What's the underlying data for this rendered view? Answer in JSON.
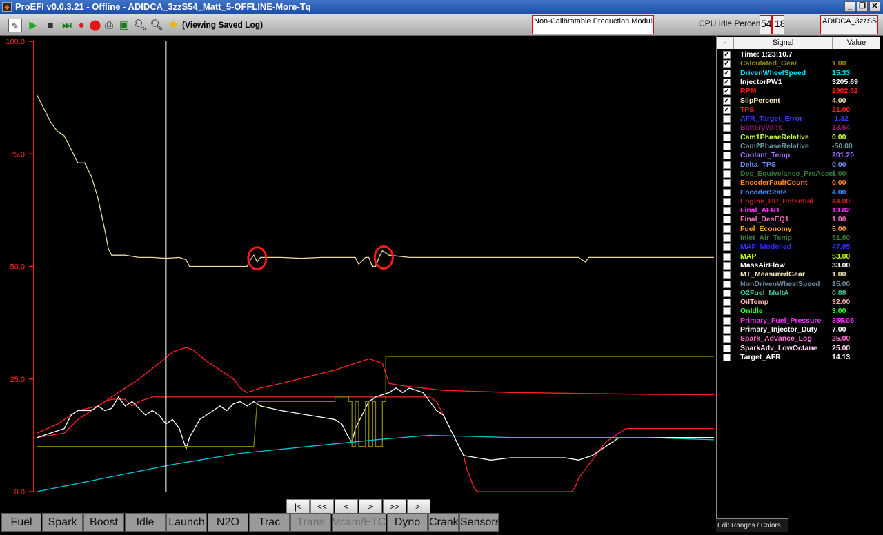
{
  "window": {
    "title": "ProEFI v0.0.3.21 - Offline - ADIDCA_3zzS54_Matt_5-OFFLINE-More-Tq",
    "minimize": "_",
    "restore": "❐",
    "close": "✕"
  },
  "toolbar": {
    "viewing_label": "(Viewing Saved Log)",
    "module_label": "Non-Calibratable Production Module",
    "cpu_label": "CPU Idle Percen",
    "cpu_value_1": "54",
    "cpu_value_2": "18",
    "ecu_id": "ADIDCA_3zzS54",
    "icons": [
      "edit-icon",
      "play-icon",
      "stop-icon",
      "step-icon",
      "record-icon",
      "stop-record-icon",
      "print-icon",
      "monitor-icon",
      "zoom-in-icon",
      "zoom-out-icon",
      "marker-icon"
    ]
  },
  "chart_data": {
    "type": "line",
    "ylim": [
      0,
      100
    ],
    "y_ticks": [
      "100.0",
      "75.0",
      "50.0",
      "25.0",
      "0.0"
    ],
    "y_tick_values": [
      100,
      75,
      50,
      25,
      0
    ],
    "x_range": [
      0,
      100
    ],
    "cursor_x": 19,
    "annotations": [
      {
        "x": 32.5,
        "y": 51.8
      },
      {
        "x": 51.2,
        "y": 52.0
      }
    ],
    "series": [
      {
        "color": "#e8d9a0",
        "points": [
          [
            0,
            88
          ],
          [
            1,
            85
          ],
          [
            2,
            82
          ],
          [
            3,
            80
          ],
          [
            4,
            79
          ],
          [
            5,
            76
          ],
          [
            6,
            73
          ],
          [
            7,
            73
          ],
          [
            8,
            70
          ],
          [
            9,
            65
          ],
          [
            10,
            58
          ],
          [
            10.5,
            54
          ],
          [
            11,
            52.5
          ],
          [
            13,
            52.5
          ],
          [
            15,
            52
          ],
          [
            17,
            52
          ],
          [
            19,
            51.8
          ],
          [
            21,
            52
          ],
          [
            22,
            51.5
          ],
          [
            22.5,
            50
          ],
          [
            30,
            50
          ],
          [
            31,
            50
          ],
          [
            31.5,
            51.5
          ],
          [
            32,
            52.5
          ],
          [
            32.5,
            51
          ],
          [
            33,
            52
          ],
          [
            36,
            52
          ],
          [
            39,
            51.8
          ],
          [
            42,
            52
          ],
          [
            45,
            52
          ],
          [
            47,
            52
          ],
          [
            47.5,
            50.5
          ],
          [
            48.5,
            52
          ],
          [
            49,
            52
          ],
          [
            49.5,
            50
          ],
          [
            50,
            50
          ],
          [
            50.5,
            52
          ],
          [
            51,
            53.5
          ],
          [
            52,
            52.5
          ],
          [
            55,
            52
          ],
          [
            60,
            52
          ],
          [
            70,
            52
          ],
          [
            80,
            52
          ],
          [
            81,
            51
          ],
          [
            81.5,
            52
          ],
          [
            90,
            52
          ],
          [
            95,
            52
          ],
          [
            100,
            52
          ]
        ]
      },
      {
        "color": "#ff2222",
        "points": [
          [
            0,
            13
          ],
          [
            3,
            15
          ],
          [
            6,
            18
          ],
          [
            9,
            19
          ],
          [
            12,
            22
          ],
          [
            15,
            25
          ],
          [
            18,
            28.5
          ],
          [
            20,
            31
          ],
          [
            22,
            32
          ],
          [
            23,
            31.5
          ],
          [
            25,
            29
          ],
          [
            27,
            27
          ],
          [
            29,
            25
          ],
          [
            30,
            23
          ],
          [
            31,
            22
          ],
          [
            33,
            23
          ],
          [
            36,
            24
          ],
          [
            40,
            25.5
          ],
          [
            44,
            27
          ],
          [
            47,
            28.5
          ],
          [
            49,
            29.5
          ],
          [
            50,
            29
          ],
          [
            51,
            28.5
          ],
          [
            52,
            24
          ],
          [
            54,
            23.5
          ],
          [
            57,
            23
          ],
          [
            60,
            22.5
          ],
          [
            70,
            22
          ],
          [
            80,
            21.8
          ],
          [
            90,
            21.6
          ],
          [
            100,
            21.5
          ]
        ]
      },
      {
        "color": "#ff2222",
        "points": [
          [
            0,
            12
          ],
          [
            2,
            12.5
          ],
          [
            4,
            13
          ],
          [
            5,
            14.5
          ],
          [
            6,
            16
          ],
          [
            7,
            17
          ],
          [
            8,
            18
          ],
          [
            9,
            19
          ],
          [
            10,
            20
          ],
          [
            11,
            20.5
          ],
          [
            13,
            20.5
          ],
          [
            14,
            19
          ],
          [
            15,
            20
          ],
          [
            16,
            20.5
          ],
          [
            17,
            21
          ],
          [
            19,
            21
          ],
          [
            20,
            21
          ],
          [
            50,
            21
          ],
          [
            51,
            21
          ],
          [
            52,
            21
          ],
          [
            55,
            21
          ],
          [
            58,
            21
          ],
          [
            59,
            20
          ],
          [
            60,
            17
          ],
          [
            61,
            14
          ],
          [
            62,
            11
          ],
          [
            63,
            8
          ],
          [
            63.5,
            5
          ],
          [
            64,
            3
          ],
          [
            64.5,
            1
          ],
          [
            65,
            0
          ],
          [
            79,
            0
          ],
          [
            79.5,
            1
          ],
          [
            80,
            3
          ],
          [
            81,
            5
          ],
          [
            82,
            7
          ],
          [
            83,
            9
          ],
          [
            84,
            11
          ],
          [
            85,
            12
          ],
          [
            86,
            13
          ],
          [
            87,
            14
          ],
          [
            100,
            14
          ]
        ]
      },
      {
        "color": "#ffffff",
        "points": [
          [
            0,
            12
          ],
          [
            2,
            13
          ],
          [
            4,
            14
          ],
          [
            5,
            17
          ],
          [
            6,
            18
          ],
          [
            8,
            18
          ],
          [
            9,
            19
          ],
          [
            10,
            18
          ],
          [
            11,
            18.5
          ],
          [
            12,
            21
          ],
          [
            13,
            19
          ],
          [
            14,
            20
          ],
          [
            15,
            18.5
          ],
          [
            16,
            17
          ],
          [
            17,
            18
          ],
          [
            18,
            17
          ],
          [
            19,
            15
          ],
          [
            20,
            16
          ],
          [
            21,
            14
          ],
          [
            22,
            9.5
          ],
          [
            22.5,
            12
          ],
          [
            24,
            16
          ],
          [
            25,
            17
          ],
          [
            26,
            18
          ],
          [
            27,
            19
          ],
          [
            28,
            18
          ],
          [
            29,
            19.5
          ],
          [
            30,
            20
          ],
          [
            31,
            19
          ],
          [
            32,
            20
          ],
          [
            33,
            19
          ],
          [
            36,
            18
          ],
          [
            40,
            17
          ],
          [
            44,
            16
          ],
          [
            45,
            15
          ],
          [
            46,
            12
          ],
          [
            46.5,
            11
          ],
          [
            47,
            14
          ],
          [
            48,
            17
          ],
          [
            49,
            20
          ],
          [
            50,
            21
          ],
          [
            51,
            21.5
          ],
          [
            52,
            22
          ],
          [
            53,
            23
          ],
          [
            54,
            22
          ],
          [
            55,
            23
          ],
          [
            56,
            22.5
          ],
          [
            57,
            22
          ],
          [
            58,
            20
          ],
          [
            59,
            18
          ],
          [
            60,
            17
          ],
          [
            61,
            14
          ],
          [
            62,
            11
          ],
          [
            63,
            8
          ],
          [
            65,
            7.5
          ],
          [
            67,
            7
          ],
          [
            70,
            7.5
          ],
          [
            75,
            7.5
          ],
          [
            78,
            7.5
          ],
          [
            80,
            7
          ],
          [
            81,
            7.5
          ],
          [
            82,
            8
          ],
          [
            83,
            9
          ],
          [
            84,
            10
          ],
          [
            85,
            11
          ],
          [
            86,
            12
          ],
          [
            87,
            12
          ],
          [
            90,
            12
          ],
          [
            95,
            12
          ],
          [
            100,
            12
          ]
        ]
      },
      {
        "color": "#8a8000",
        "points": [
          [
            0,
            10
          ],
          [
            32,
            10
          ],
          [
            32.5,
            20
          ],
          [
            44,
            20
          ],
          [
            44,
            21
          ],
          [
            46,
            21
          ],
          [
            46,
            20
          ],
          [
            46.5,
            20
          ],
          [
            46.5,
            10
          ],
          [
            47,
            10
          ],
          [
            47,
            20
          ],
          [
            47.5,
            20
          ],
          [
            47.5,
            10
          ],
          [
            48.5,
            10
          ],
          [
            48.5,
            20
          ],
          [
            49,
            20
          ],
          [
            49,
            10
          ],
          [
            49.5,
            10
          ],
          [
            49.5,
            20
          ],
          [
            50,
            20
          ],
          [
            50,
            10
          ],
          [
            51,
            10
          ],
          [
            51,
            20
          ],
          [
            51.5,
            20
          ],
          [
            51.5,
            30
          ],
          [
            100,
            30
          ]
        ]
      },
      {
        "color": "#00c8d8",
        "points": [
          [
            0,
            0
          ],
          [
            10,
            3
          ],
          [
            20,
            6
          ],
          [
            30,
            8.5
          ],
          [
            40,
            10
          ],
          [
            50,
            11.5
          ],
          [
            58,
            12.5
          ],
          [
            70,
            12
          ],
          [
            80,
            12
          ],
          [
            90,
            12
          ],
          [
            100,
            11.5
          ]
        ]
      }
    ]
  },
  "signal_panel": {
    "col_minus": "-",
    "col_signal": "Signal",
    "col_value": "Value",
    "rows": [
      {
        "name": "Time: 1:23:10.7",
        "value": "",
        "color": "#ffffff",
        "checked": true
      },
      {
        "name": "Calculated_Gear",
        "value": "1.00",
        "color": "#8a8a00",
        "checked": true
      },
      {
        "name": "DrivenWheelSpeed",
        "value": "15.33",
        "color": "#00e5ff",
        "checked": true
      },
      {
        "name": "InjectorPW1",
        "value": "3205.69",
        "color": "#ffffff",
        "checked": true
      },
      {
        "name": "RPM",
        "value": "2902.82",
        "color": "#ff2020",
        "checked": true
      },
      {
        "name": "SlipPercent",
        "value": "4.00",
        "color": "#f5e6b8",
        "checked": true
      },
      {
        "name": "TPS",
        "value": "21.00",
        "color": "#ff2020",
        "checked": true
      },
      {
        "name": "AFR_Target_Error",
        "value": "-1.32",
        "color": "#3b3bff",
        "checked": false
      },
      {
        "name": "BatteryVolts",
        "value": "13.64",
        "color": "#8b1a6a",
        "checked": false
      },
      {
        "name": "Cam1PhaseRelative",
        "value": "0.00",
        "color": "#c8ff40",
        "checked": false
      },
      {
        "name": "Cam2PhaseRelative",
        "value": "-50.00",
        "color": "#6a9aa8",
        "checked": false
      },
      {
        "name": "Coolant_Temp",
        "value": "201.20",
        "color": "#a070ff",
        "checked": false
      },
      {
        "name": "Delta_TPS",
        "value": "0.00",
        "color": "#7090ff",
        "checked": false
      },
      {
        "name": "Des_Equivelance_PreAccel",
        "value": "1.00",
        "color": "#2e7d32",
        "checked": false
      },
      {
        "name": "EncoderFaultCount",
        "value": "0.00",
        "color": "#ff8c1a",
        "checked": false
      },
      {
        "name": "EncoderState",
        "value": "4.00",
        "color": "#3a8aff",
        "checked": false
      },
      {
        "name": "Engine_HP_Potential",
        "value": "44.00",
        "color": "#c02020",
        "checked": false
      },
      {
        "name": "Final_AFR1",
        "value": "13.82",
        "color": "#ff30ff",
        "checked": false
      },
      {
        "name": "Final_DesEQ1",
        "value": "1.00",
        "color": "#f070c0",
        "checked": false
      },
      {
        "name": "Fuel_Economy",
        "value": "5.00",
        "color": "#ffa030",
        "checked": false
      },
      {
        "name": "Inlet_Air_Temp",
        "value": "51.80",
        "color": "#3a7a3a",
        "checked": false
      },
      {
        "name": "MAF_Modelled",
        "value": "47.85",
        "color": "#3030ff",
        "checked": false
      },
      {
        "name": "MAP",
        "value": "53.00",
        "color": "#c0ff00",
        "checked": false
      },
      {
        "name": "MassAirFlow",
        "value": "33.00",
        "color": "#ffffff",
        "checked": false
      },
      {
        "name": "MT_MeasuredGear",
        "value": "1.00",
        "color": "#f5e6b8",
        "checked": false
      },
      {
        "name": "NonDrivenWheelSpeed",
        "value": "15.00",
        "color": "#6a8aa0",
        "checked": false
      },
      {
        "name": "O2Fuel_MultA",
        "value": "0.88",
        "color": "#40c0a0",
        "checked": false
      },
      {
        "name": "OilTemp",
        "value": "32.00",
        "color": "#ffb0b0",
        "checked": false
      },
      {
        "name": "OnIdle",
        "value": "3.00",
        "color": "#30ff30",
        "checked": false
      },
      {
        "name": "Primary_Fuel_Pressure",
        "value": "355.05",
        "color": "#ff30ff",
        "checked": false
      },
      {
        "name": "Primary_Injector_Duty",
        "value": "7.00",
        "color": "#ffffff",
        "checked": false
      },
      {
        "name": "Spark_Advance_Log",
        "value": "25.00",
        "color": "#ff70d0",
        "checked": false
      },
      {
        "name": "SparkAdv_LowOctane",
        "value": "25.00",
        "color": "#ffd0f0",
        "checked": false
      },
      {
        "name": "Target_AFR",
        "value": "14.13",
        "color": "#ffffff",
        "checked": false
      }
    ],
    "edit_ranges": "Edit Ranges / Colors"
  },
  "nav": [
    "|<",
    "<<",
    "<",
    ">",
    ">>",
    ">|"
  ],
  "tabs": [
    {
      "label": "Fuel",
      "dim": false
    },
    {
      "label": "Spark",
      "dim": false
    },
    {
      "label": "Boost",
      "dim": false
    },
    {
      "label": "Idle",
      "dim": false
    },
    {
      "label": "Launch",
      "dim": false
    },
    {
      "label": "N2O",
      "dim": false
    },
    {
      "label": "Trac",
      "dim": false
    },
    {
      "label": "Trans",
      "dim": true
    },
    {
      "label": "Vcam/ETC",
      "dim": true
    },
    {
      "label": "Dyno",
      "dim": false
    },
    {
      "label": "Crank",
      "dim": false
    },
    {
      "label": "Sensors",
      "dim": false
    }
  ]
}
